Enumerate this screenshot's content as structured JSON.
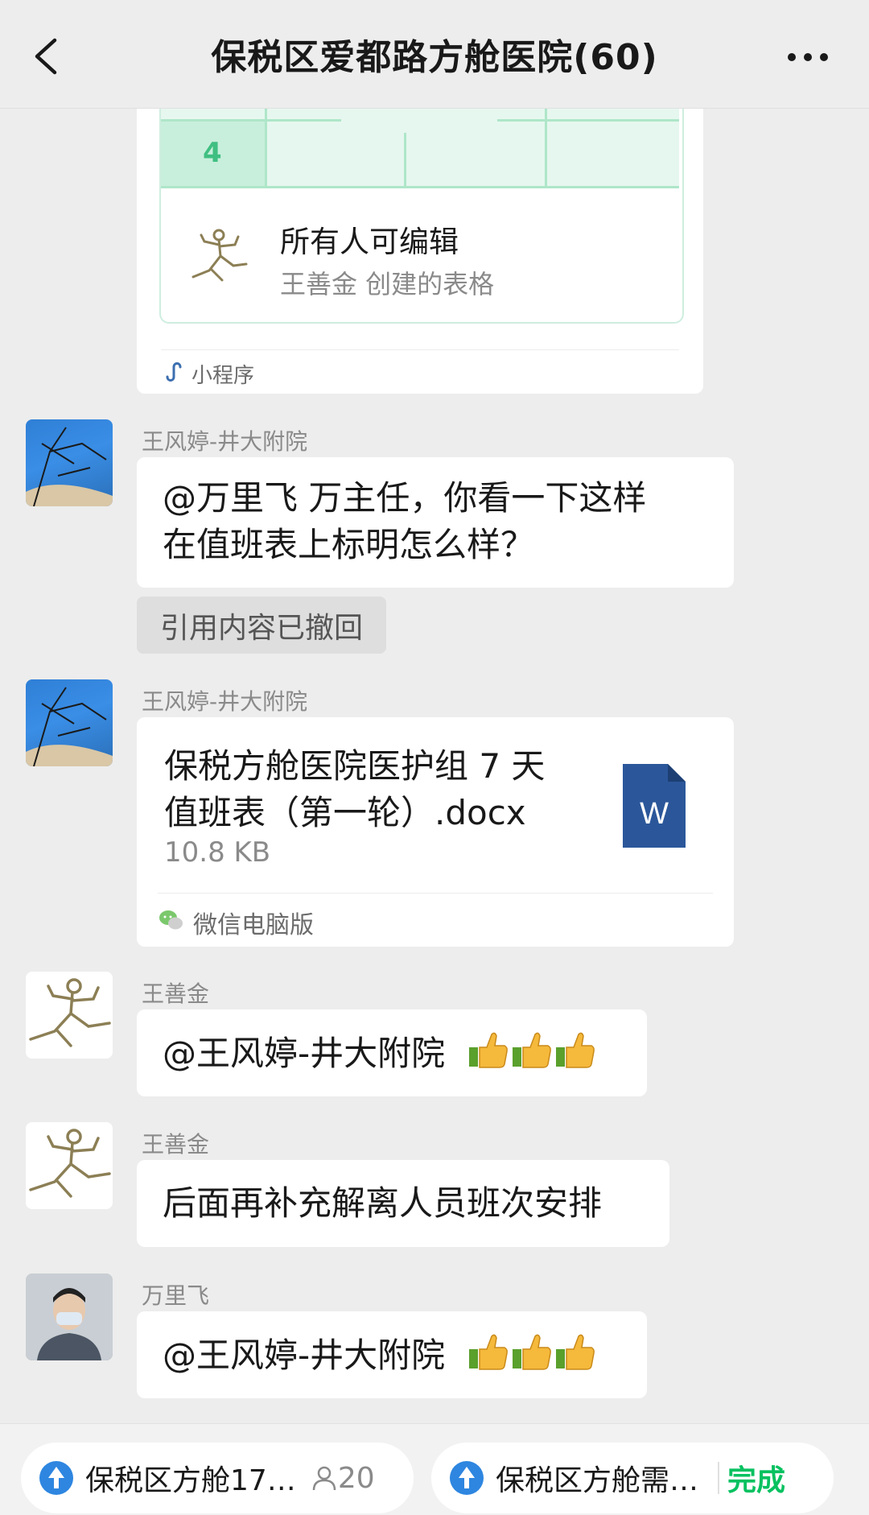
{
  "header": {
    "title": "保税区爱都路方舱医院(60)"
  },
  "mini_program": {
    "sheet_number": "4",
    "title": "所有人可编辑",
    "subtitle": "王善金 创建的表格",
    "footer_label": "小程序"
  },
  "messages": [
    {
      "sender": "王风婷-井大附院",
      "text_lines": [
        "@万里飞  万主任，你看一下这样",
        "在值班表上标明怎么样？"
      ]
    },
    {
      "quote": "引用内容已撤回"
    },
    {
      "sender": "王风婷-井大附院",
      "file_name_lines": [
        "保税方舱医院医护组 7 天",
        "值班表（第一轮）.docx"
      ],
      "file_size": "10.8 KB",
      "file_icon_letter": "W",
      "source": "微信电脑版"
    },
    {
      "sender": "王善金",
      "text": "@王风婷-井大附院"
    },
    {
      "sender": "王善金",
      "text": "后面再补充解离人员班次安排"
    },
    {
      "sender": "万里飞",
      "text": "@王风婷-井大附院"
    }
  ],
  "bottom": {
    "left_pill": {
      "text": "保税区方舱17…",
      "count": "20"
    },
    "right_pill": {
      "text": "保税区方舱需…",
      "action": "完成"
    }
  },
  "colors": {
    "accent_green": "#07c160",
    "word_blue": "#2b579a",
    "background": "#ededed"
  }
}
